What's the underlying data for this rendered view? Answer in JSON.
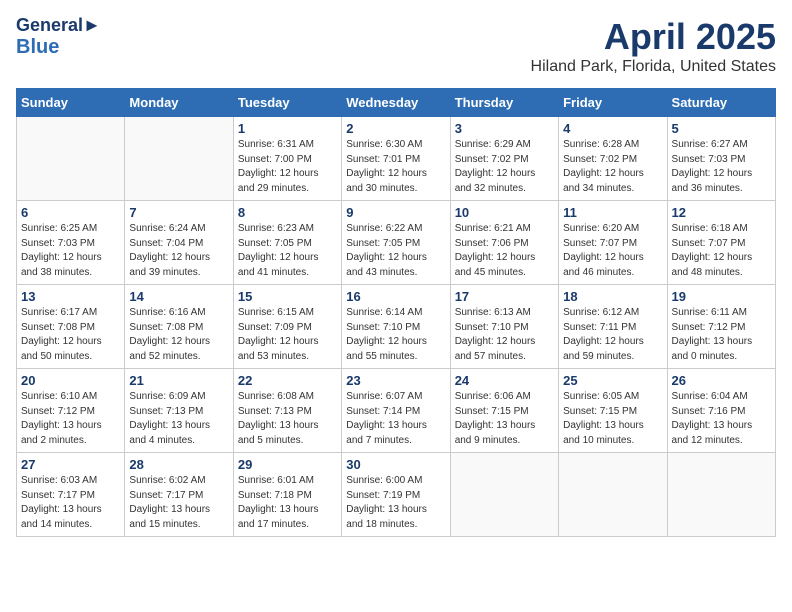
{
  "header": {
    "logo_line1": "General",
    "logo_line2": "Blue",
    "month_title": "April 2025",
    "location": "Hiland Park, Florida, United States"
  },
  "weekdays": [
    "Sunday",
    "Monday",
    "Tuesday",
    "Wednesday",
    "Thursday",
    "Friday",
    "Saturday"
  ],
  "weeks": [
    [
      {
        "day": "",
        "details": ""
      },
      {
        "day": "",
        "details": ""
      },
      {
        "day": "1",
        "details": "Sunrise: 6:31 AM\nSunset: 7:00 PM\nDaylight: 12 hours\nand 29 minutes."
      },
      {
        "day": "2",
        "details": "Sunrise: 6:30 AM\nSunset: 7:01 PM\nDaylight: 12 hours\nand 30 minutes."
      },
      {
        "day": "3",
        "details": "Sunrise: 6:29 AM\nSunset: 7:02 PM\nDaylight: 12 hours\nand 32 minutes."
      },
      {
        "day": "4",
        "details": "Sunrise: 6:28 AM\nSunset: 7:02 PM\nDaylight: 12 hours\nand 34 minutes."
      },
      {
        "day": "5",
        "details": "Sunrise: 6:27 AM\nSunset: 7:03 PM\nDaylight: 12 hours\nand 36 minutes."
      }
    ],
    [
      {
        "day": "6",
        "details": "Sunrise: 6:25 AM\nSunset: 7:03 PM\nDaylight: 12 hours\nand 38 minutes."
      },
      {
        "day": "7",
        "details": "Sunrise: 6:24 AM\nSunset: 7:04 PM\nDaylight: 12 hours\nand 39 minutes."
      },
      {
        "day": "8",
        "details": "Sunrise: 6:23 AM\nSunset: 7:05 PM\nDaylight: 12 hours\nand 41 minutes."
      },
      {
        "day": "9",
        "details": "Sunrise: 6:22 AM\nSunset: 7:05 PM\nDaylight: 12 hours\nand 43 minutes."
      },
      {
        "day": "10",
        "details": "Sunrise: 6:21 AM\nSunset: 7:06 PM\nDaylight: 12 hours\nand 45 minutes."
      },
      {
        "day": "11",
        "details": "Sunrise: 6:20 AM\nSunset: 7:07 PM\nDaylight: 12 hours\nand 46 minutes."
      },
      {
        "day": "12",
        "details": "Sunrise: 6:18 AM\nSunset: 7:07 PM\nDaylight: 12 hours\nand 48 minutes."
      }
    ],
    [
      {
        "day": "13",
        "details": "Sunrise: 6:17 AM\nSunset: 7:08 PM\nDaylight: 12 hours\nand 50 minutes."
      },
      {
        "day": "14",
        "details": "Sunrise: 6:16 AM\nSunset: 7:08 PM\nDaylight: 12 hours\nand 52 minutes."
      },
      {
        "day": "15",
        "details": "Sunrise: 6:15 AM\nSunset: 7:09 PM\nDaylight: 12 hours\nand 53 minutes."
      },
      {
        "day": "16",
        "details": "Sunrise: 6:14 AM\nSunset: 7:10 PM\nDaylight: 12 hours\nand 55 minutes."
      },
      {
        "day": "17",
        "details": "Sunrise: 6:13 AM\nSunset: 7:10 PM\nDaylight: 12 hours\nand 57 minutes."
      },
      {
        "day": "18",
        "details": "Sunrise: 6:12 AM\nSunset: 7:11 PM\nDaylight: 12 hours\nand 59 minutes."
      },
      {
        "day": "19",
        "details": "Sunrise: 6:11 AM\nSunset: 7:12 PM\nDaylight: 13 hours\nand 0 minutes."
      }
    ],
    [
      {
        "day": "20",
        "details": "Sunrise: 6:10 AM\nSunset: 7:12 PM\nDaylight: 13 hours\nand 2 minutes."
      },
      {
        "day": "21",
        "details": "Sunrise: 6:09 AM\nSunset: 7:13 PM\nDaylight: 13 hours\nand 4 minutes."
      },
      {
        "day": "22",
        "details": "Sunrise: 6:08 AM\nSunset: 7:13 PM\nDaylight: 13 hours\nand 5 minutes."
      },
      {
        "day": "23",
        "details": "Sunrise: 6:07 AM\nSunset: 7:14 PM\nDaylight: 13 hours\nand 7 minutes."
      },
      {
        "day": "24",
        "details": "Sunrise: 6:06 AM\nSunset: 7:15 PM\nDaylight: 13 hours\nand 9 minutes."
      },
      {
        "day": "25",
        "details": "Sunrise: 6:05 AM\nSunset: 7:15 PM\nDaylight: 13 hours\nand 10 minutes."
      },
      {
        "day": "26",
        "details": "Sunrise: 6:04 AM\nSunset: 7:16 PM\nDaylight: 13 hours\nand 12 minutes."
      }
    ],
    [
      {
        "day": "27",
        "details": "Sunrise: 6:03 AM\nSunset: 7:17 PM\nDaylight: 13 hours\nand 14 minutes."
      },
      {
        "day": "28",
        "details": "Sunrise: 6:02 AM\nSunset: 7:17 PM\nDaylight: 13 hours\nand 15 minutes."
      },
      {
        "day": "29",
        "details": "Sunrise: 6:01 AM\nSunset: 7:18 PM\nDaylight: 13 hours\nand 17 minutes."
      },
      {
        "day": "30",
        "details": "Sunrise: 6:00 AM\nSunset: 7:19 PM\nDaylight: 13 hours\nand 18 minutes."
      },
      {
        "day": "",
        "details": ""
      },
      {
        "day": "",
        "details": ""
      },
      {
        "day": "",
        "details": ""
      }
    ]
  ]
}
